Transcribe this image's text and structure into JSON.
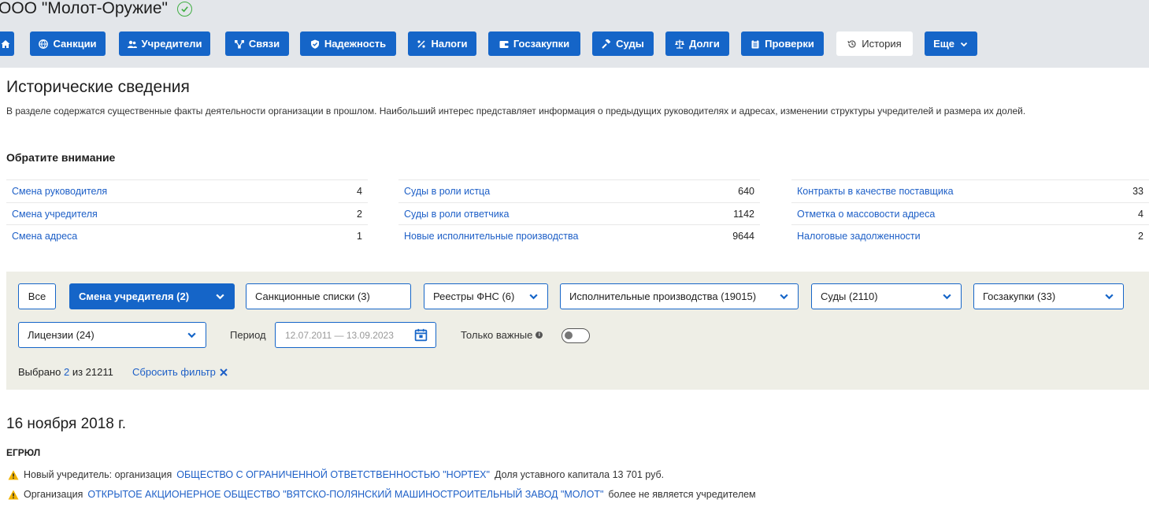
{
  "header": {
    "company_name": "ООО \"Молот-Оружие\"",
    "verified_icon": "check-circle-icon"
  },
  "nav_tabs": [
    {
      "key": "home",
      "label": "",
      "icon": "home-icon"
    },
    {
      "key": "sanctions",
      "label": "Санкции",
      "icon": "globe-icon"
    },
    {
      "key": "founders",
      "label": "Учредители",
      "icon": "users-icon"
    },
    {
      "key": "links",
      "label": "Связи",
      "icon": "network-icon"
    },
    {
      "key": "reliability",
      "label": "Надежность",
      "icon": "shield-icon"
    },
    {
      "key": "taxes",
      "label": "Налоги",
      "icon": "percent-icon"
    },
    {
      "key": "procurement",
      "label": "Госзакупки",
      "icon": "wallet-icon"
    },
    {
      "key": "courts",
      "label": "Суды",
      "icon": "gavel-icon"
    },
    {
      "key": "debts",
      "label": "Долги",
      "icon": "scales-icon"
    },
    {
      "key": "inspections",
      "label": "Проверки",
      "icon": "clipboard-icon"
    },
    {
      "key": "history",
      "label": "История",
      "icon": "history-icon",
      "active": true
    },
    {
      "key": "more",
      "label": "Еще",
      "icon": "chevron-down-icon"
    }
  ],
  "main": {
    "title": "Исторические сведения",
    "description": "В разделе содержатся существенные факты деятельности организации в прошлом. Наибольший интерес представляет информация о предыдущих руководителях и адресах, изменении структуры учредителей и размера их долей.",
    "attention_title": "Обратите внимание"
  },
  "attention": [
    [
      {
        "label": "Смена руководителя",
        "value": "4"
      },
      {
        "label": "Смена учредителя",
        "value": "2"
      },
      {
        "label": "Смена адреса",
        "value": "1"
      }
    ],
    [
      {
        "label": "Суды в роли истца",
        "value": "640"
      },
      {
        "label": "Суды в роли ответчика",
        "value": "1142"
      },
      {
        "label": "Новые исполнительные производства",
        "value": "9644"
      }
    ],
    [
      {
        "label": "Контракты в качестве поставщика",
        "value": "33"
      },
      {
        "label": "Отметка о массовости адреса",
        "value": "4"
      },
      {
        "label": "Налоговые задолженности",
        "value": "2"
      }
    ]
  ],
  "filters": {
    "all_label": "Все",
    "founder_change": "Смена учредителя (2)",
    "sanctions": "Санкционные списки (3)",
    "fns": "Реестры ФНС (6)",
    "enforcement": "Исполнительные производства (19015)",
    "courts": "Суды (2110)",
    "procurement": "Госзакупки (33)",
    "licenses": "Лицензии (24)",
    "period_label": "Период",
    "period_value": "12.07.2011 — 13.09.2023",
    "only_important": "Только важные",
    "only_important_on": false,
    "selected_prefix": "Выбрано",
    "selected_count": "2",
    "selected_suffix": "из 21211",
    "reset_label": "Сбросить фильтр"
  },
  "events": {
    "date": "16 ноября 2018 г.",
    "source": "ЕГРЮЛ",
    "items": [
      {
        "prefix": "Новый учредитель: организация",
        "link": "ОБЩЕСТВО С ОГРАНИЧЕННОЙ ОТВЕТСТВЕННОСТЬЮ \"НОРТЕХ\"",
        "suffix": "Доля уставного капитала 13 701 руб."
      },
      {
        "prefix": "Организация",
        "link": "ОТКРЫТОЕ АКЦИОНЕРНОЕ ОБЩЕСТВО \"ВЯТСКО-ПОЛЯНСКИЙ МАШИНОСТРОИТЕЛЬНЫЙ ЗАВОД \"МОЛОТ\"",
        "suffix": "более не является учредителем"
      }
    ]
  },
  "colors": {
    "primary": "#1565c8",
    "link": "#1d5fc7",
    "success": "#3fae42",
    "warning": "#f2b400",
    "filter_panel": "#eeeee6",
    "header_band": "#e3e6ea"
  }
}
